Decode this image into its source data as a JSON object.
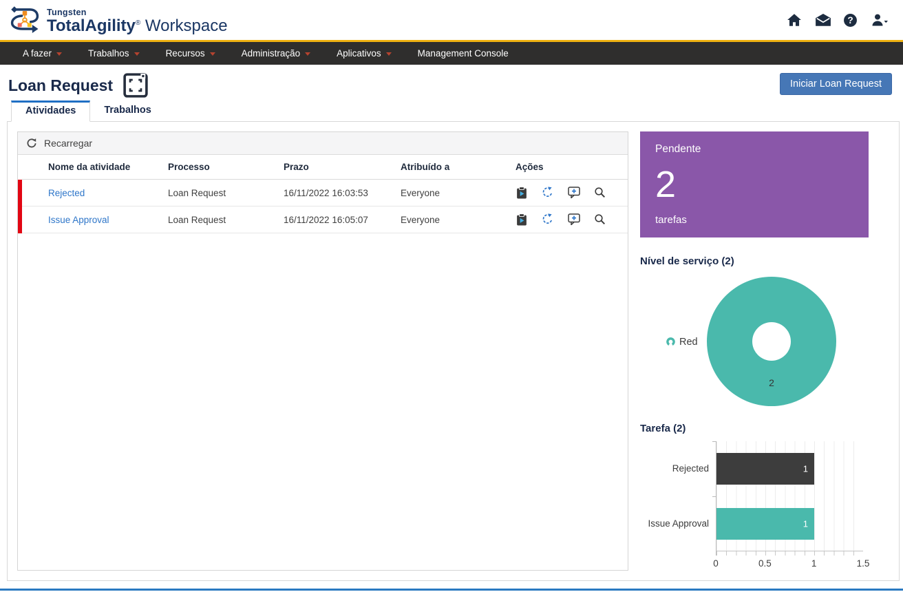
{
  "brand": {
    "prefix": "Tungsten",
    "name": "TotalAgility",
    "registered": "®",
    "suffix": " Workspace"
  },
  "header_icons": [
    "home-icon",
    "mail-icon",
    "help-icon",
    "user-menu-icon"
  ],
  "navbar": {
    "items": [
      {
        "label": "A fazer",
        "caret": true
      },
      {
        "label": "Trabalhos",
        "caret": true
      },
      {
        "label": "Recursos",
        "caret": true
      },
      {
        "label": "Administração",
        "caret": true
      },
      {
        "label": "Aplicativos",
        "caret": true
      },
      {
        "label": "Management Console",
        "caret": false
      }
    ]
  },
  "page": {
    "title": "Loan Request",
    "start_button_label": "Iniciar Loan Request",
    "tabs": [
      {
        "label": "Atividades",
        "active": true
      },
      {
        "label": "Trabalhos",
        "active": false
      }
    ]
  },
  "grid": {
    "reload_label": "Recarregar",
    "columns": [
      "Nome da atividade",
      "Processo",
      "Prazo",
      "Atribuído a",
      "Ações"
    ],
    "rows": [
      {
        "name": "Rejected",
        "process": "Loan Request",
        "due": "16/11/2022 16:03:53",
        "assigned_to": "Everyone",
        "priority_indicator": "red"
      },
      {
        "name": "Issue Approval",
        "process": "Loan Request",
        "due": "16/11/2022 16:05:07",
        "assigned_to": "Everyone",
        "priority_indicator": "red"
      }
    ],
    "row_actions": [
      "open-activity-icon",
      "reassign-icon",
      "add-note-icon",
      "view-details-icon"
    ]
  },
  "dashboard": {
    "pending_card": {
      "label": "Pendente",
      "count": 2,
      "unit": "tarefas",
      "color": "#8a57a9"
    }
  },
  "chart_data": [
    {
      "type": "pie",
      "donut": true,
      "title": "Nível de serviço (2)",
      "labels": [
        "Red"
      ],
      "values": [
        2
      ],
      "colors": [
        "#4ab9ac"
      ],
      "data_labels": [
        2
      ],
      "legend_position": "left"
    },
    {
      "type": "bar",
      "orientation": "horizontal",
      "title": "Tarefa (2)",
      "categories": [
        "Rejected",
        "Issue Approval"
      ],
      "values": [
        1,
        1
      ],
      "colors": [
        "#3d3d3d",
        "#4ab9ac"
      ],
      "data_labels": [
        1,
        1
      ],
      "xlim": [
        0,
        1.5
      ],
      "x_ticks": [
        0,
        0.5,
        1,
        1.5
      ],
      "grid": "vertical-minor",
      "legend": false
    }
  ],
  "colors": {
    "brand_navy": "#1b3764",
    "accent_yellow": "#eeb111",
    "navbar_bg": "#2f2e2d",
    "caret_red": "#b5432f",
    "link_blue": "#2e76c9",
    "button_blue": "#4677b6",
    "row_indicator_red": "#e20613",
    "pending_purple": "#8a57a9",
    "teal": "#4ab9ac",
    "dark_bar": "#3d3d3d",
    "footer_blue": "#2a7ac1"
  }
}
